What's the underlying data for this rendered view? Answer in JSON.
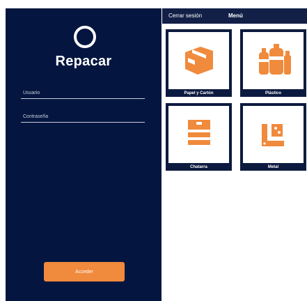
{
  "login": {
    "brand": "Repacar",
    "username_label": "Usuario",
    "password_label": "Contraseña",
    "submit_label": "Acceder"
  },
  "menu": {
    "logout_label": "Cerrar sesión",
    "title": "Menú",
    "tiles": [
      {
        "label": "Papel y Cartón",
        "icon": "cardboard-box-icon"
      },
      {
        "label": "Plástico",
        "icon": "plastic-bottles-icon"
      },
      {
        "label": "Chatarra",
        "icon": "scrap-stack-icon"
      },
      {
        "label": "Metal",
        "icon": "metal-parts-icon"
      }
    ]
  },
  "colors": {
    "navy": "#041640",
    "header": "#122048",
    "accent_orange": "#f08a3c",
    "white": "#ffffff"
  }
}
